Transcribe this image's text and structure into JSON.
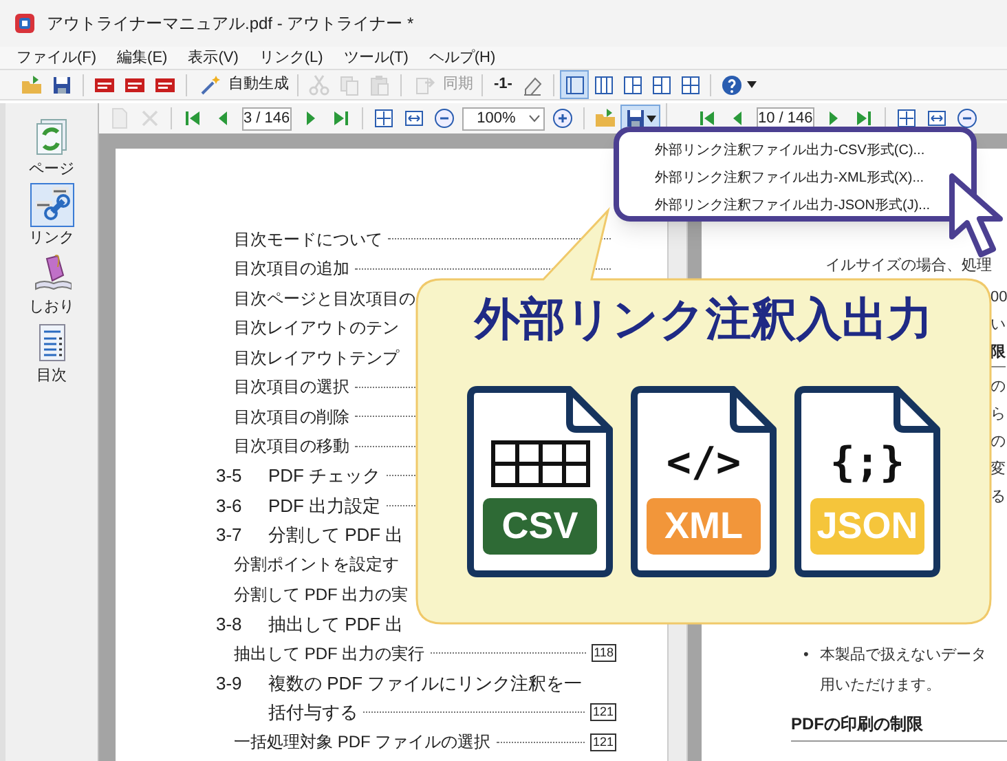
{
  "window": {
    "title": "アウトライナーマニュアル.pdf - アウトライナー *"
  },
  "menu_bar": [
    {
      "label": "ファイル(F)"
    },
    {
      "label": "編集(E)"
    },
    {
      "label": "表示(V)"
    },
    {
      "label": "リンク(L)"
    },
    {
      "label": "ツール(T)"
    },
    {
      "label": "ヘルプ(H)"
    }
  ],
  "toolbar": {
    "auto_generate": {
      "label": "自動生成"
    },
    "edit_disabled": true,
    "sync": {
      "label": "同期",
      "disabled": true
    },
    "page_label": "-1-",
    "layouts": [
      {
        "selected": true
      },
      {
        "selected": false
      },
      {
        "selected": false
      },
      {
        "selected": false
      },
      {
        "selected": false
      }
    ]
  },
  "left_toolbar": {
    "page_actions_disabled": true,
    "page_field": "3 / 146",
    "zoom": "100%",
    "export_menu_open": true
  },
  "right_toolbar": {
    "page_field": "10 / 146"
  },
  "sidebar": {
    "items": [
      {
        "label": "ページ",
        "selected": false
      },
      {
        "label": "リンク",
        "selected": true
      },
      {
        "label": "しおり",
        "selected": false
      },
      {
        "label": "目次",
        "selected": false
      }
    ]
  },
  "left_page": {
    "lines": [
      {
        "kind": "item",
        "text": "目次モードについて",
        "leader": true
      },
      {
        "kind": "item",
        "text": "目次項目の追加",
        "leader": true
      },
      {
        "kind": "item",
        "text": "目次ページと目次項目の"
      },
      {
        "kind": "item",
        "text": "目次レイアウトのテン"
      },
      {
        "kind": "item",
        "text": "目次レイアウトテンプ"
      },
      {
        "kind": "item",
        "text": "目次項目の選択",
        "leader": true
      },
      {
        "kind": "item",
        "text": "目次項目の削除",
        "leader": true
      },
      {
        "kind": "item",
        "text": "目次項目の移動",
        "leader": true
      },
      {
        "kind": "section",
        "number": "3-5",
        "text": "PDF チェック",
        "leader": true
      },
      {
        "kind": "section",
        "number": "3-6",
        "text": "PDF 出力設定",
        "leader": true
      },
      {
        "kind": "section",
        "number": "3-7",
        "text": "分割して PDF 出"
      },
      {
        "kind": "item",
        "text": "分割ポイントを設定す"
      },
      {
        "kind": "item",
        "text": "分割して PDF 出力の実"
      },
      {
        "kind": "section",
        "number": "3-8",
        "text": "抽出して PDF 出"
      },
      {
        "kind": "item",
        "text": "抽出して PDF 出力の実行",
        "leader": true,
        "page": "118"
      },
      {
        "kind": "section",
        "number": "3-9",
        "text": "複数の PDF ファイルにリンク注釈を一"
      },
      {
        "kind": "continuation",
        "text": "括付与する",
        "leader": true,
        "page": "121"
      },
      {
        "kind": "item",
        "text": "一括処理対象 PDF ファイルの選択",
        "leader": true,
        "page": "121"
      }
    ]
  },
  "right_page": {
    "top_text": "イルサイズの場合、処理",
    "edge_fragments": [
      {
        "kind": "text",
        "text": "00"
      },
      {
        "kind": "text",
        "text": "い"
      },
      {
        "kind": "heading",
        "text": "限"
      },
      {
        "kind": "text",
        "text": "の"
      },
      {
        "kind": "text",
        "text": "ら"
      },
      {
        "kind": "text",
        "text": "の"
      },
      {
        "kind": "text",
        "text": "変"
      },
      {
        "kind": "text",
        "text": "る"
      }
    ],
    "bullets": [
      {
        "marker": "•",
        "lines": [
          "本製品で扱えないデータ",
          "用いただけます。"
        ]
      }
    ],
    "heading": "PDFの印刷の制限"
  },
  "export_menu": {
    "items": [
      {
        "label": "外部リンク注釈ファイル出力-CSV形式(C)..."
      },
      {
        "label": "外部リンク注釈ファイル出力-XML形式(X)..."
      },
      {
        "label": "外部リンク注釈ファイル出力-JSON形式(J)..."
      }
    ]
  },
  "callout": {
    "title": "外部リンク注釈入出力",
    "formats": [
      {
        "kind": "table",
        "label": "CSV",
        "color": "#2e6a35"
      },
      {
        "kind": "code",
        "symbol": "</>",
        "label": "XML",
        "color": "#f2963a"
      },
      {
        "kind": "code",
        "symbol": "{;}",
        "label": "JSON",
        "color": "#f5c53b"
      }
    ]
  }
}
